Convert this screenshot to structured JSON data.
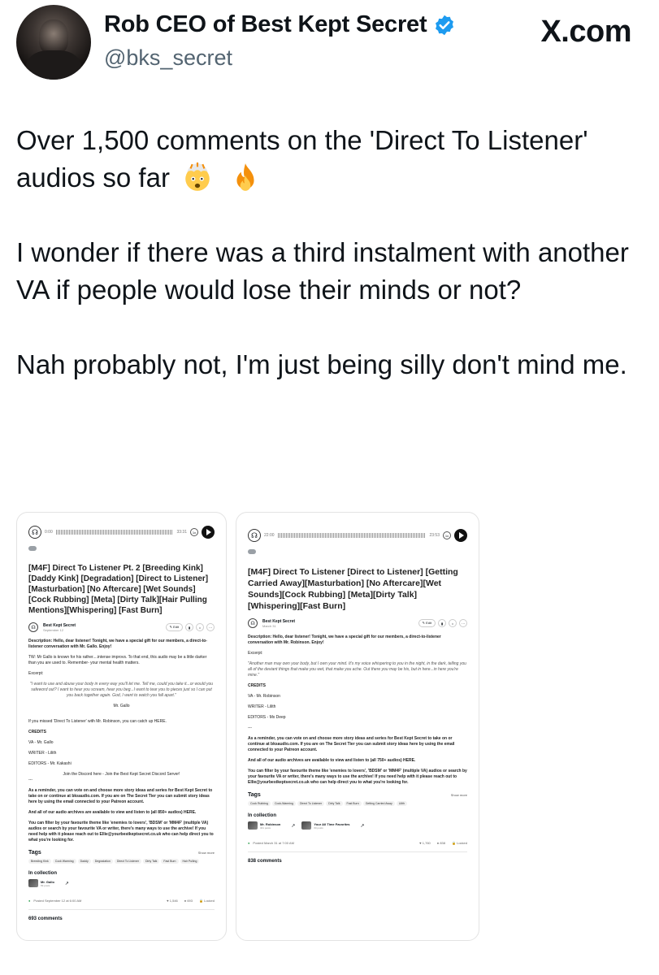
{
  "header": {
    "name": "Rob CEO of Best Kept Secret",
    "handle": "@bks_secret",
    "site": "X.com"
  },
  "tweet": {
    "p1": "Over 1,500 comments on the 'Direct To Listener' audios so far",
    "p2": "I wonder if there was a third instalment with another VA if people would lose their minds or not?",
    "p3": "Nah probably not, I'm just being silly don't mind me."
  },
  "left": {
    "time_start": "0:00",
    "time_end": "33:31",
    "pill": "Best Kept Secret",
    "title": "[M4F] Direct To Listener Pt. 2 [Breeding Kink] [Daddy Kink] [Degradation] [Direct to Listener] [Masturbation] [No Aftercare] [Wet Sounds] [Cock Rubbing] [Meta] [Dirty Talk][Hair Pulling Mentions][Whispering] [Fast Burn]",
    "author": "Best Kept Secret",
    "date": "September 12",
    "edit": "Edit",
    "desc1": "Description: Hello, dear listener! Tonight, we have a special gift for our members, a direct-to-listener conversation with Mr. Gallo. Enjoy!",
    "desc2": "TW: Mr Gallo is known for his rather....intense improvs. To that end, this audio may be a little darker than you are used to. Remember- your mental health matters.",
    "excerpt_label": "Excerpt:",
    "excerpt": "\"I want to use and abuse your body in every way you'll let me. Tell me, could you take it...or would you safeword out? I want to hear you scream, hear you beg...I want to tear you to pieces just so I can put you back together again. God, I want to watch you fall apart.\"",
    "excerpt_by": "Mr. Gallo",
    "missed": "If you missed 'Direct To Listener' with Mr. Robinson, you can catch up HERE.",
    "credits": "CREDITS",
    "va": "VA - Mr. Gallo",
    "writer": "WRITER - Lilith",
    "editors": "EDITORS - Mr. Kakashi",
    "discord": "Join the Discord here - Join the Best Kept Secret Discord Server!",
    "sep": "---",
    "remind": "As a reminder, you can vote on and choose more story ideas and series for Best Kept Secret to take on or continue at bksaudio.com. If you are on The Secret Tier you can submit story ideas here by using the email connected to your Patreon account.",
    "archives": "And all of our audio archives are available to view and listen to (all 850+ audios) HERE.",
    "filter": "You can filter by your favourite theme like 'enemies to lovers', 'BDSM' or 'MM4F' (multiple VA) audios or search by your favourite VA or writer, there's many ways to use the archive! If you need help with it please reach out to Ellie@yourbestkeptsecret.co.uk who can help direct you to what you're looking for.",
    "tags_label": "Tags",
    "show_more": "Show more",
    "tags": [
      "Breeding Kink",
      "Cock Warming",
      "Daddy",
      "Degradation",
      "Direct To Listener",
      "Dirty Talk",
      "Fast Burn",
      "Hair Pulling"
    ],
    "collection_label": "In collection",
    "collections": [
      {
        "name": "Mr. Gallo",
        "count": "69 posts"
      }
    ],
    "posted": "Posted September 12 at 6:00 AM",
    "likes": "1,546",
    "comments_count": "693",
    "locked": "Locked",
    "comments": "693 comments"
  },
  "right": {
    "time_start": "22:00",
    "time_end": "23:53",
    "pill": "Best Kept Secret",
    "title": "[M4F] Direct To Listener [Direct to Listener] [Getting Carried Away][Masturbation] [No Aftercare][Wet Sounds][Cock Rubbing] [Meta][Dirty Talk][Whispering][Fast Burn]",
    "author": "Best Kept Secret",
    "date": "March 31",
    "edit": "Edit",
    "desc1": "Description: Hello, dear listener! Tonight, we have a special gift for our members, a direct-to-listener conversation with Mr. Robinson. Enjoy!",
    "excerpt_label": "Excerpt:",
    "excerpt": "\"Another man may own your body, but I own your mind. It's my voice whispering to you in the night, in the dark, telling you all of the deviant things that make you wet, that make you ache. Out there you may be his, but in here...in here you're mine.\"",
    "credits": "CREDITS",
    "va": "VA - Mr. Robinson",
    "writer": "WRITER - Lilith",
    "editors": "EDITORS - Mx Deep",
    "sep": "---",
    "remind": "As a reminder, you can vote on and choose more story ideas and series for Best Kept Secret to take on or continue at bksaudio.com. If you are on The Secret Tier you can submit story ideas here by using the email connected to your Patreon account.",
    "archives": "And all of our audio archives are available to view and listen to (all 750+ audios) HERE.",
    "filter": "You can filter by your favourite theme like 'enemies to lovers', 'BDSM' or 'MM4F' (multiple VA) audios or search by your favourite VA or writer, there's many ways to use the archive! If you need help with it please reach out to Ellie@yourbestkeptsecret.co.uk who can help direct you to what you're looking for.",
    "tags_label": "Tags",
    "show_more": "Show more",
    "tags": [
      "Cock Rubbing",
      "Cock-Warming",
      "Direct To Listener",
      "Dirty Talk",
      "Fast Burn",
      "Getting Carried Away",
      "Lilith"
    ],
    "collection_label": "In collection",
    "collections": [
      {
        "name": "Mr. Robinson",
        "count": "341 posts"
      },
      {
        "name": "Your All Time Favorites",
        "count": "60 posts"
      }
    ],
    "posted": "Posted March 31 at 7:00 AM",
    "likes": "1,760",
    "comments_count": "838",
    "locked": "Locked",
    "comments": "838 comments"
  }
}
